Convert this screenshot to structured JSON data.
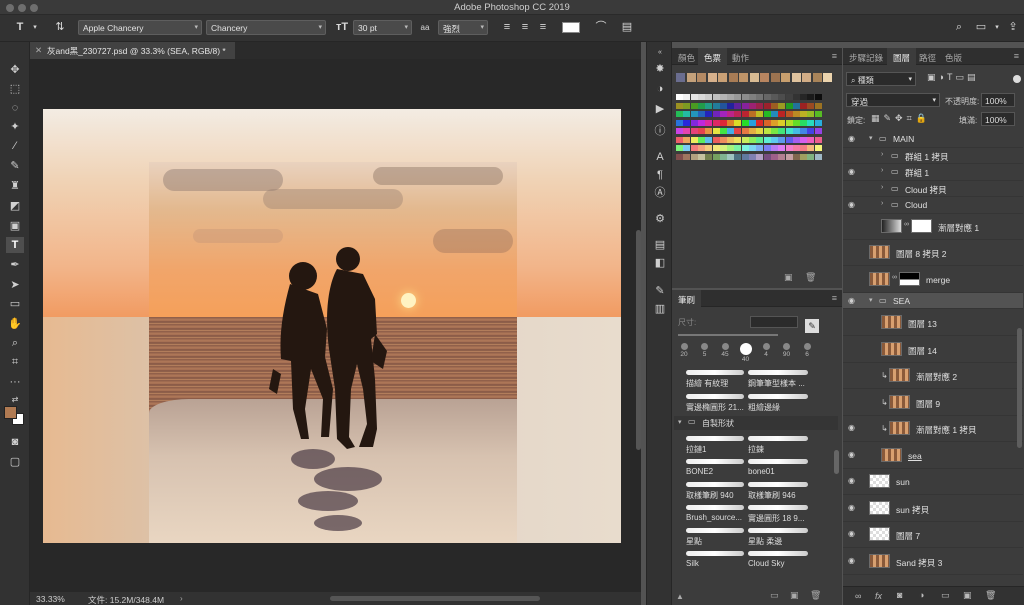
{
  "window": {
    "title": "Adobe Photoshop CC 2019"
  },
  "options_bar": {
    "tool_icon": "T",
    "font_family": "Apple Chancery",
    "font_style": "Chancery",
    "font_size": "30 pt",
    "antialias": "強烈"
  },
  "document_tab": {
    "title": "灰and黑_230727.psd @ 33.3% (SEA, RGB/8) *"
  },
  "status": {
    "zoom": "33.33%",
    "doc_size": "文件: 15.2M/348.4M"
  },
  "swatches_panel": {
    "tabs": [
      "顏色",
      "色票",
      "動作"
    ],
    "active_tab": "色票",
    "recent_colors": [
      "#6a6d8f",
      "#c4a17b",
      "#b48a64",
      "#d7b18c",
      "#caa176",
      "#a87c55",
      "#bf9468",
      "#d8bb93",
      "#b88560",
      "#9c7350",
      "#c89f6e",
      "#e0c39e",
      "#d2ad86",
      "#a98459",
      "#ecd4ad"
    ]
  },
  "brush_panel": {
    "title": "筆刷",
    "size_label": "尺寸:",
    "presets": [
      "20",
      "5",
      "45",
      "40",
      "4",
      "90",
      "6"
    ],
    "brushes_row1": [
      "描繪 有紋理",
      "鋼筆筆型樣本 ..."
    ],
    "brushes_row2": [
      "實邊橢圓形 21...",
      "粗繪邊緣"
    ],
    "group_name": "自製形狀",
    "group_items": [
      [
        "拉鏈1",
        "拉鍊"
      ],
      [
        "BONE2",
        "bone01"
      ],
      [
        "取樣筆刷 940",
        "取樣筆刷 946"
      ],
      [
        "Brush_source...",
        "實邊圓形 18 9..."
      ],
      [
        "星點",
        "星點 柔邊"
      ],
      [
        "Silk",
        "Cloud Sky"
      ]
    ]
  },
  "layers_panel": {
    "tabs": [
      "步驟記錄",
      "圖層",
      "路徑",
      "色版"
    ],
    "active_tab": "圖層",
    "filter_label": "種類",
    "blend_mode": "穿過",
    "opacity_label": "不透明度:",
    "opacity": "100%",
    "lock_label": "鎖定:",
    "fill_label": "填滿:",
    "fill": "100%",
    "layers": [
      {
        "name": "MAIN",
        "kind": "group",
        "visible": true,
        "indent": 0,
        "expanded": true
      },
      {
        "name": "群組 1 拷貝",
        "kind": "group",
        "visible": false,
        "indent": 1
      },
      {
        "name": "群組 1",
        "kind": "group",
        "visible": true,
        "indent": 1
      },
      {
        "name": "Cloud 拷貝",
        "kind": "group",
        "visible": false,
        "indent": 1
      },
      {
        "name": "Cloud",
        "kind": "group",
        "visible": true,
        "indent": 1
      },
      {
        "name": "漸層對應 1",
        "kind": "adjust",
        "visible": false,
        "indent": 1
      },
      {
        "name": "圖層 8 拷貝 2",
        "kind": "pixel",
        "visible": false,
        "indent": 0
      },
      {
        "name": "merge",
        "kind": "masked",
        "visible": false,
        "indent": 0
      },
      {
        "name": "SEA",
        "kind": "group",
        "visible": true,
        "indent": 0,
        "expanded": true,
        "selected": true
      },
      {
        "name": "圖層 13",
        "kind": "pixel",
        "visible": false,
        "indent": 1
      },
      {
        "name": "圖層 14",
        "kind": "pixel",
        "visible": false,
        "indent": 1
      },
      {
        "name": "漸層對應 2",
        "kind": "clip",
        "visible": false,
        "indent": 1
      },
      {
        "name": "圖層 9",
        "kind": "clip",
        "visible": false,
        "indent": 1
      },
      {
        "name": "漸層對應 1 拷貝",
        "kind": "clip",
        "visible": true,
        "indent": 1
      },
      {
        "name": "sea",
        "kind": "pixel",
        "visible": true,
        "indent": 1
      },
      {
        "name": "sun",
        "kind": "pixel",
        "visible": true,
        "indent": 0
      },
      {
        "name": "sun 拷貝",
        "kind": "pixel",
        "visible": true,
        "indent": 0
      },
      {
        "name": "圖層 7",
        "kind": "pixel",
        "visible": true,
        "indent": 0
      },
      {
        "name": "Sand 拷貝 3",
        "kind": "pixel",
        "visible": true,
        "indent": 0
      }
    ]
  }
}
